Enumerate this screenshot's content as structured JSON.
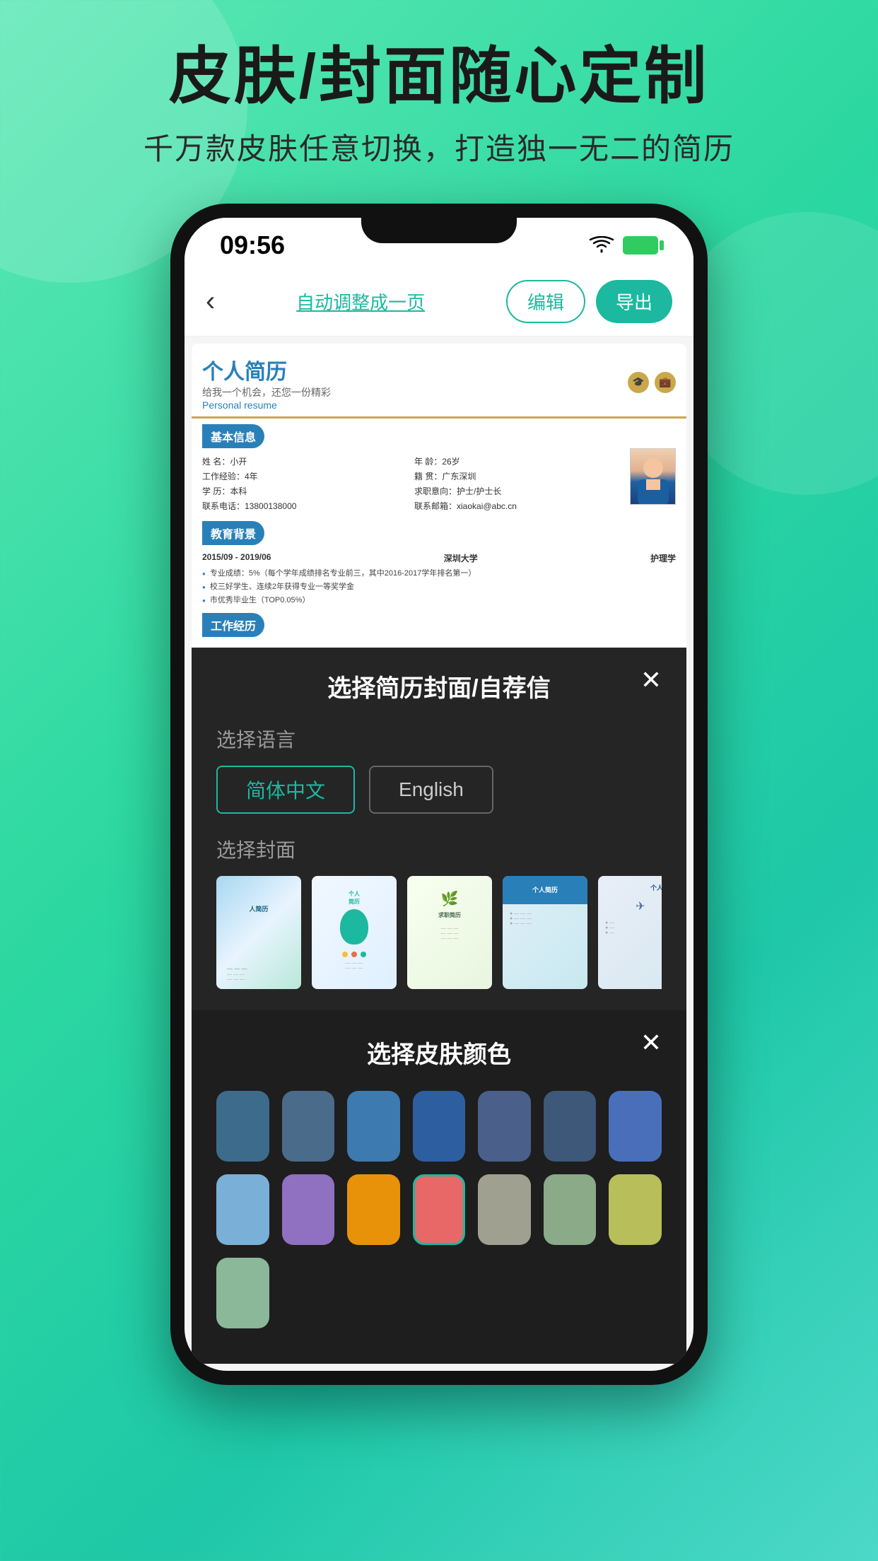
{
  "app": {
    "background_gradient_start": "#5de8b5",
    "background_gradient_end": "#1ec8a8"
  },
  "header": {
    "main_title": "皮肤/封面随心定制",
    "sub_title": "千万款皮肤任意切换，打造独一无二的简历"
  },
  "phone": {
    "status_bar": {
      "time": "09:56",
      "wifi": "wifi",
      "battery": "battery"
    },
    "nav": {
      "back_icon": "‹",
      "auto_adjust_label": "自动调整成一页",
      "edit_button": "编辑",
      "export_button": "导出"
    },
    "resume": {
      "title_cn": "个人简历",
      "title_sub": "给我一个机会，还您一份精彩",
      "title_en": "Personal resume",
      "section_basic": "基本信息",
      "fields": [
        {
          "label": "姓  名：",
          "value": "小开"
        },
        {
          "label": "年  龄：",
          "value": "26岁"
        },
        {
          "label": "工作经验：",
          "value": "4年"
        },
        {
          "label": "籍  贯：",
          "value": "广东深圳"
        },
        {
          "label": "学  历：",
          "value": "本科"
        },
        {
          "label": "求职意向：",
          "value": "护士/护士长"
        },
        {
          "label": "联系电话：",
          "value": "13800138000"
        },
        {
          "label": "联系邮箱：",
          "value": "xiaokai@abc.cn"
        }
      ],
      "section_edu": "教育背景",
      "edu_period": "2015/09 - 2019/06",
      "edu_school": "深圳大学",
      "edu_major": "护理学",
      "edu_bullets": [
        "专业成绩：5%（每个学年成绩排名专业前三，其中2016-2017学年排名第一）",
        "校三好学生、连续2年获得专业一等奖学金",
        "市优秀毕业生（TOP0.05%）"
      ],
      "section_work": "工作经历"
    }
  },
  "cover_modal": {
    "title": "选择简历封面/自荐信",
    "close_icon": "✕",
    "lang_section_label": "选择语言",
    "lang_options": [
      {
        "label": "简体中文",
        "active": true
      },
      {
        "label": "English",
        "active": false
      }
    ],
    "cover_section_label": "选择封面",
    "covers": [
      {
        "id": 1,
        "style": "watercolor-blue",
        "text": "人简历"
      },
      {
        "id": 2,
        "style": "balloon-teal",
        "text": "个人\n简历"
      },
      {
        "id": 3,
        "style": "leaf-green",
        "text": "求职简历"
      },
      {
        "id": 4,
        "style": "clean-blue",
        "text": "个人简历"
      },
      {
        "id": 5,
        "style": "paper-plane",
        "text": "个人简历"
      }
    ]
  },
  "skin_modal": {
    "title": "选择皮肤颜色",
    "close_icon": "✕",
    "colors_row1": [
      {
        "id": "c1",
        "hex": "#3d6b8c"
      },
      {
        "id": "c2",
        "hex": "#4a6b8a"
      },
      {
        "id": "c3",
        "hex": "#3d7ab0"
      },
      {
        "id": "c4",
        "hex": "#2d5fa0"
      },
      {
        "id": "c5",
        "hex": "#4a5f8a"
      },
      {
        "id": "c6",
        "hex": "#3d5878"
      },
      {
        "id": "c7",
        "hex": "#4a6fba"
      }
    ],
    "colors_row2": [
      {
        "id": "c8",
        "hex": "#7ab0d8"
      },
      {
        "id": "c9",
        "hex": "#9070c0"
      },
      {
        "id": "c10",
        "hex": "#e8920a"
      },
      {
        "id": "c11",
        "hex": "#e86868",
        "selected": true
      },
      {
        "id": "c12",
        "hex": "#a0a090"
      },
      {
        "id": "c13",
        "hex": "#8aaa88"
      },
      {
        "id": "c14",
        "hex": "#b8be5a"
      },
      {
        "id": "c15",
        "hex": "#8ab898"
      }
    ]
  }
}
